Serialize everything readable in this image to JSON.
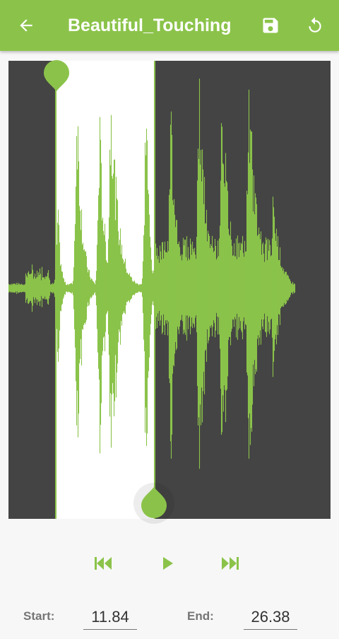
{
  "app_bar": {
    "title": "Beautiful_Touching",
    "back_icon": "arrow-left-icon",
    "save_icon": "save-floppy-icon",
    "reset_icon": "reset-rotate-icon",
    "color": "#8bc34a"
  },
  "waveform": {
    "wave_color": "#8bc34a",
    "dark_bg": "#444444",
    "selected_bg": "#ffffff",
    "start_marker_icon": "start-marker-icon",
    "end_marker_icon": "end-marker-icon"
  },
  "controls": {
    "previous_icon": "skip-previous-icon",
    "play_icon": "play-icon",
    "next_icon": "skip-next-icon"
  },
  "fields": {
    "start_label": "Start:",
    "start_value": "11.84",
    "end_label": "End:",
    "end_value": "26.38"
  }
}
